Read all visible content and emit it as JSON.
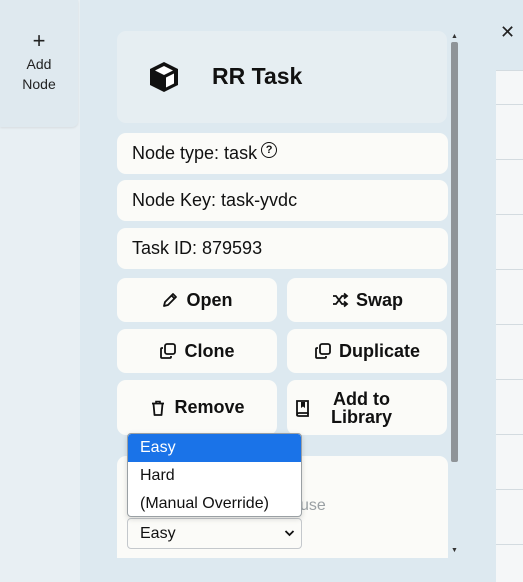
{
  "sidebar": {
    "add_node_line1": "Add",
    "add_node_line2": "Node"
  },
  "panel": {
    "title": "RR Task",
    "node_type": "Node type: task",
    "node_key": "Node Key: task-yvdc",
    "task_id": "Task ID: 879593",
    "buttons": {
      "open": "Open",
      "swap": "Swap",
      "clone": "Clone",
      "duplicate": "Duplicate",
      "remove": "Remove",
      "add_to_library_line1": "Add to",
      "add_to_library_line2": "Library"
    },
    "difficulty": {
      "partial_label": "use",
      "selected": "Easy",
      "options": [
        "Easy",
        "Hard",
        "(Manual Override)"
      ]
    }
  },
  "icons": {
    "close": "close-icon",
    "plus": "plus-icon",
    "cube": "cube-icon",
    "help": "help-icon",
    "pencil": "pencil-icon",
    "shuffle": "shuffle-icon",
    "copy": "copy-icon",
    "trash": "trash-icon",
    "book": "book-icon"
  },
  "colors": {
    "accent": "#1a73e8",
    "card": "#fbfbf8",
    "background": "#dde9f0"
  }
}
